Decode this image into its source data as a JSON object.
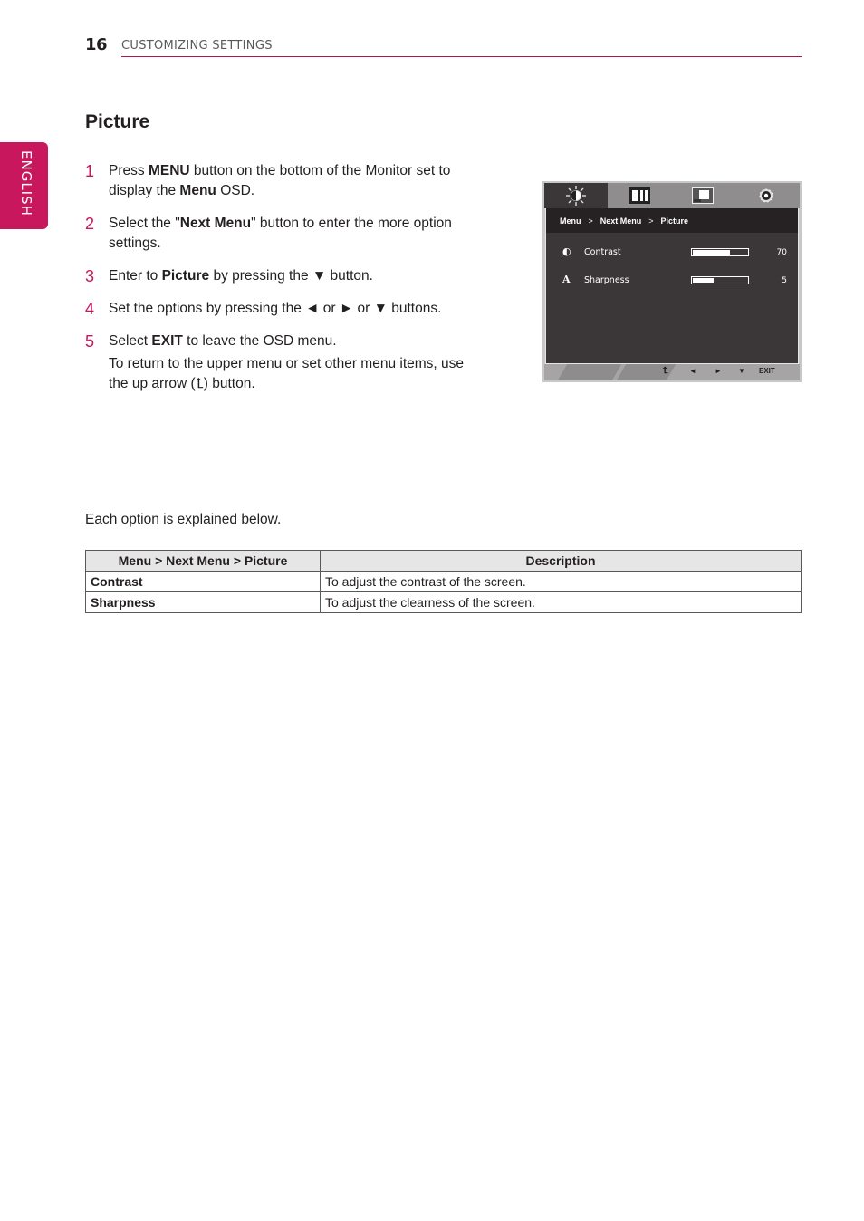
{
  "header": {
    "page_number": "16",
    "section": "CUSTOMIZING SETTINGS",
    "language_tab": "ENGLISH",
    "accent_color": "#c8175d"
  },
  "title": "Picture",
  "steps": [
    {
      "num": "1",
      "parts": [
        {
          "t": "Press "
        },
        {
          "b": "MENU"
        },
        {
          "t": " button on the bottom of the Monitor set to display the "
        },
        {
          "b": "Menu"
        },
        {
          "t": " OSD."
        }
      ]
    },
    {
      "num": "2",
      "parts": [
        {
          "t": "Select the \""
        },
        {
          "b": "Next Menu"
        },
        {
          "t": "\" button to enter the more option settings."
        }
      ]
    },
    {
      "num": "3",
      "parts": [
        {
          "t": "Enter to "
        },
        {
          "b": "Picture"
        },
        {
          "t": " by pressing the ▼ button."
        }
      ]
    },
    {
      "num": "4",
      "parts": [
        {
          "t": "Set the options by pressing the ◄ or ► or ▼ buttons."
        }
      ]
    },
    {
      "num": "5",
      "parts": [
        {
          "t": "Select "
        },
        {
          "b": "EXIT"
        },
        {
          "t": " to leave the OSD menu."
        }
      ],
      "sub": "To return to the upper menu or set other menu items, use the up arrow (⮤) button."
    }
  ],
  "osd": {
    "tabs": [
      {
        "icon": "brightness-icon",
        "active": true
      },
      {
        "icon": "picture-bars-icon",
        "active": false
      },
      {
        "icon": "screen-position-icon",
        "active": false
      },
      {
        "icon": "settings-gear-icon",
        "active": false
      }
    ],
    "breadcrumb": [
      "Menu",
      "Next Menu",
      "Picture"
    ],
    "breadcrumb_sep": ">",
    "rows": [
      {
        "icon": "◐",
        "icon_name": "contrast-icon",
        "label": "Contrast",
        "value": "70",
        "fraction": 0.7
      },
      {
        "icon": "A",
        "icon_name": "sharpness-icon",
        "label": "Sharpness",
        "value": "5",
        "fraction": 0.4
      }
    ],
    "footer_buttons": [
      {
        "name": "up-arrow-button",
        "label": "⮤"
      },
      {
        "name": "left-button",
        "label": "◄"
      },
      {
        "name": "right-button",
        "label": "►"
      },
      {
        "name": "down-button",
        "label": "▼"
      },
      {
        "name": "exit-button",
        "label": "EXIT"
      }
    ]
  },
  "intro": "Each option is explained below.",
  "table": {
    "headers": [
      "Menu > Next Menu > Picture",
      "Description"
    ],
    "rows": [
      [
        "Contrast",
        "To adjust the contrast of the screen."
      ],
      [
        "Sharpness",
        "To adjust the clearness of the screen."
      ]
    ]
  }
}
